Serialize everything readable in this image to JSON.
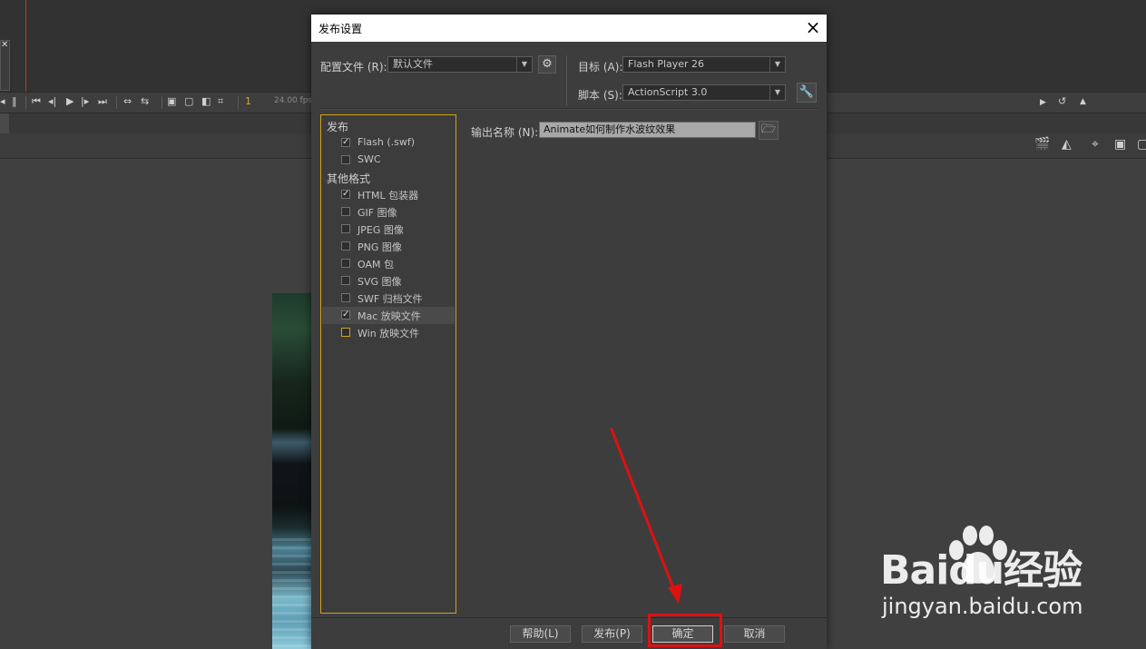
{
  "background": {
    "frame_number": "1",
    "fps": "24.00 fps"
  },
  "dialog": {
    "title": "发布设置",
    "close_glyph": "×",
    "profile_label": "配置文件 (R):",
    "profile_value": "默认文件",
    "target_label": "目标 (A):",
    "target_value": "Flash Player 26",
    "script_label": "脚本 (S):",
    "script_value": "ActionScript 3.0",
    "output_label": "输出名称 (N):",
    "output_value": "Animate如何制作水波纹效果",
    "tree": {
      "publish_category": "发布",
      "other_category": "其他格式",
      "items": [
        {
          "label": "Flash (.swf)",
          "checked": true
        },
        {
          "label": "SWC",
          "checked": false
        },
        {
          "label": "HTML 包装器",
          "checked": true
        },
        {
          "label": "GIF 图像",
          "checked": false
        },
        {
          "label": "JPEG 图像",
          "checked": false
        },
        {
          "label": "PNG 图像",
          "checked": false
        },
        {
          "label": "OAM 包",
          "checked": false
        },
        {
          "label": "SVG 图像",
          "checked": false
        },
        {
          "label": "SWF 归档文件",
          "checked": false
        },
        {
          "label": "Mac 放映文件",
          "checked": true
        },
        {
          "label": "Win 放映文件",
          "checked": false
        }
      ]
    },
    "buttons": {
      "help": "帮助(L)",
      "publish": "发布(P)",
      "ok": "确定",
      "cancel": "取消"
    }
  },
  "watermark": {
    "brand": "Baidu经验",
    "url": "jingyan.baidu.com"
  },
  "colors": {
    "highlight": "#e01010",
    "tree_border": "#d2a019"
  }
}
